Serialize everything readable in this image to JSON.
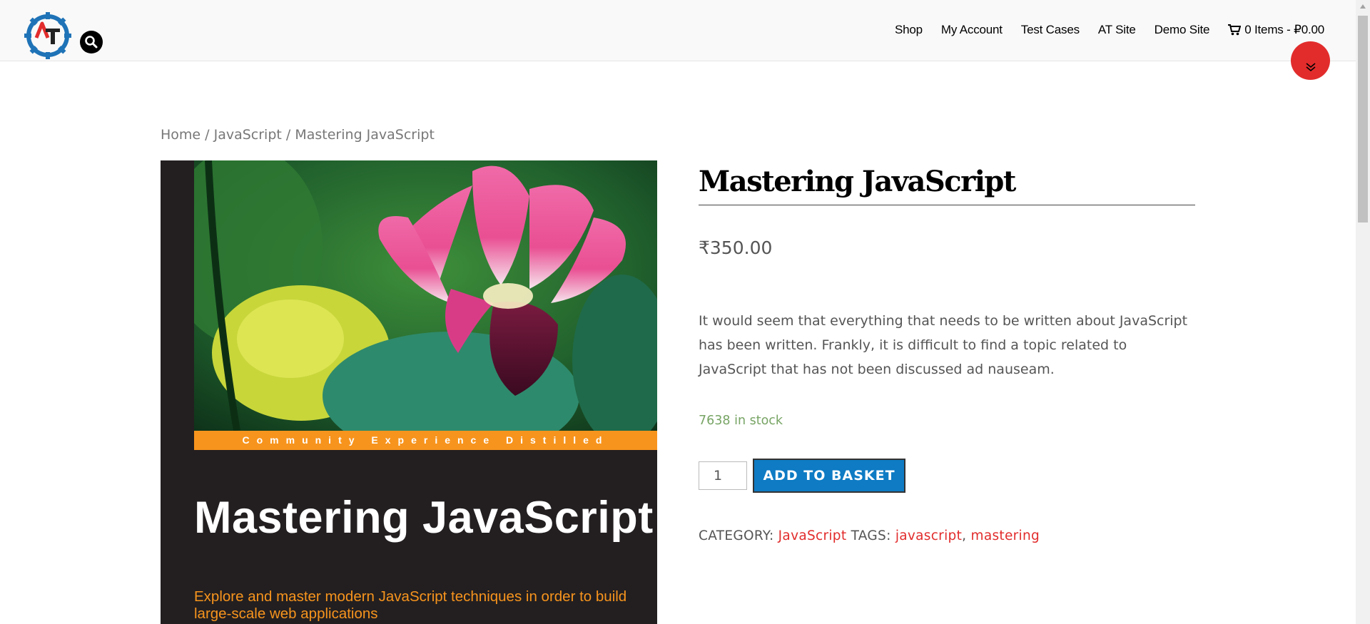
{
  "header": {
    "logo_text": "AT",
    "nav": [
      "Shop",
      "My Account",
      "Test Cases",
      "AT Site",
      "Demo Site"
    ],
    "cart_label": "0 Items - ₽0.00"
  },
  "breadcrumb": {
    "home": "Home",
    "category": "JavaScript",
    "current": "Mastering JavaScript",
    "separator": "/"
  },
  "cover": {
    "band_text": "Community Experience Distilled",
    "title": "Mastering JavaScript",
    "subtitle": "Explore and master modern JavaScript techniques in order to build large-scale web applications"
  },
  "product": {
    "title": "Mastering JavaScript",
    "price": "₹350.00",
    "description": "It would seem that everything that needs to be written about JavaScript has been written. Frankly, it is difficult to find a topic related to JavaScript that has not been discussed ad nauseam.",
    "stock": "7638 in stock",
    "quantity": "1",
    "add_button": "ADD TO BASKET",
    "category_label": "CATEGORY:",
    "category": "JavaScript",
    "tags_label": "TAGS:",
    "tags": [
      "javascript",
      "mastering"
    ],
    "tag_separator": ","
  },
  "colors": {
    "accent_red": "#e22c2c",
    "button_blue": "#0e7bc4",
    "stock_green": "#77a464",
    "cover_orange": "#f7941d"
  }
}
